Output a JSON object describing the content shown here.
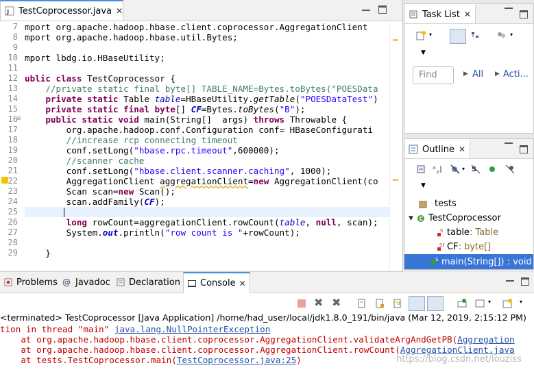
{
  "editor": {
    "tab_title": "TestCoprocessor.java",
    "line_numbers": [
      "7",
      "8",
      "9",
      "10",
      "11",
      "12",
      "13",
      "14",
      "15",
      "16",
      "17",
      "18",
      "19",
      "20",
      "21",
      "22",
      "23",
      "24",
      "25",
      "26",
      "27",
      "28",
      "29"
    ],
    "lines": {
      "l7a": "mport org.apache.hadoop.hbase.client.coprocessor.AggregationClient",
      "l8a": "mport org.apache.hadoop.hbase.util.Bytes;",
      "l10a": "mport lbdg.io.HBaseUtility;",
      "l12k": "ublic class",
      "l12b": " TestCoprocessor {",
      "l13": "    //private static final byte[] TABLE_NAME=Bytes.toBytes(\"POESData",
      "l14k": "    private static",
      "l14b": " Table ",
      "l14f": "table",
      "l14c": "=HBaseUtility.",
      "l14m": "getTable",
      "l14d": "(",
      "l14s": "\"POESDataTest\"",
      "l14e": ")",
      "l15k": "    private static final byte",
      "l15b": "[] ",
      "l15f": "CF",
      "l15c": "=Bytes.",
      "l15m": "toBytes",
      "l15d": "(",
      "l15s": "\"B\"",
      "l15e": ");",
      "l16k": "    public static void",
      "l16b": " main(String[]  args) ",
      "l16k2": "throws",
      "l16c": " Throwable {",
      "l17": "        org.apache.hadoop.conf.Configuration conf= HBaseConfigurati",
      "l18": "        //increase rcp connecting timeout",
      "l19a": "        conf.setLong(",
      "l19s": "\"hbase.rpc.timeout\"",
      "l19b": ",600000);",
      "l20": "        //scanner cache",
      "l21a": "        conf.setLong(",
      "l21s": "\"hbase.client.scanner.caching\"",
      "l21b": ", 1000);",
      "l22a": "        AggregationClient ",
      "l22w": "aggregationClient",
      "l22b": "=",
      "l22k": "new",
      "l22c": " AggregationClient(co",
      "l23a": "        Scan scan=",
      "l23k": "new",
      "l23b": " Scan();",
      "l24a": "        scan.addFamily(",
      "l24f": "CF",
      "l24b": ");",
      "l26k": "        long",
      "l26a": " rowCount=aggregationClient.rowCount(",
      "l26f": "table",
      "l26b": ", ",
      "l26k2": "null",
      "l26c": ", scan);",
      "l27a": "        System.",
      "l27f": "out",
      "l27b": ".println(",
      "l27s": "\"row count is \"",
      "l27c": "+rowCount);",
      "l29": "    }"
    }
  },
  "tasklist": {
    "title": "Task List",
    "find_placeholder": "Find",
    "all_label": "All",
    "activate_label": "Acti..."
  },
  "outline": {
    "title": "Outline",
    "items": [
      {
        "label": "tests"
      },
      {
        "label": "TestCoprocessor"
      },
      {
        "label": "table",
        "type": " : Table"
      },
      {
        "label": "CF",
        "type": " : byte[]"
      },
      {
        "label": "main(String[]) : void"
      }
    ]
  },
  "bottom": {
    "tabs": [
      "Problems",
      "Javadoc",
      "Declaration",
      "Console"
    ],
    "terminated": "<terminated> TestCoprocessor [Java Application] /home/had_user/local/jdk1.8.0_191/bin/java (Mar 12, 2019, 2:15:12 PM)",
    "l1a": "tion in thread \"main\" ",
    "l1b": "java.lang.NullPointerException",
    "l2a": "    at org.apache.hadoop.hbase.client.coprocessor.AggregationClient.validateArgAndGetPB(",
    "l2b": "Aggregation",
    "l3a": "    at org.apache.hadoop.hbase.client.coprocessor.AggregationClient.rowCount(",
    "l3b": "AggregationClient.java",
    "l4a": "    at tests.TestCoprocessor.main(",
    "l4b": "TestCoprocessor.java:25",
    "l4c": ")",
    "watermark": "https://blog.csdn.net/louziss"
  },
  "colors": {
    "accent": "#4a90d9",
    "selection": "#3875d7",
    "error": "#c00000"
  }
}
